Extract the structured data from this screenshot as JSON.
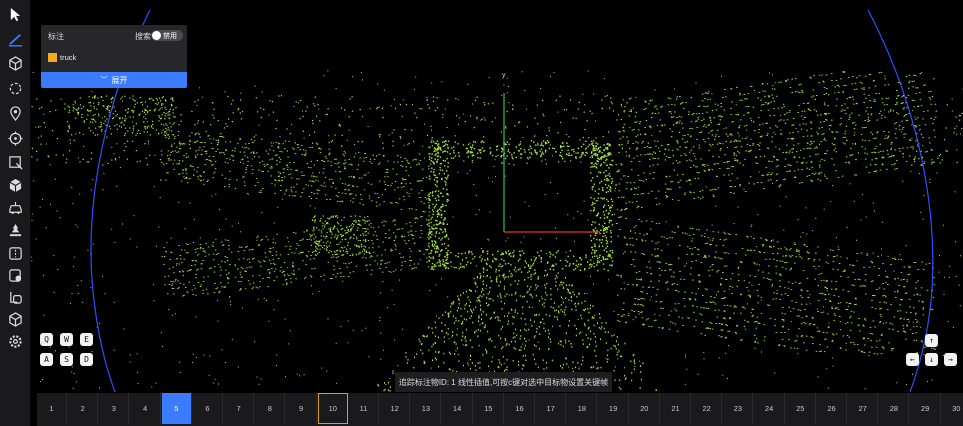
{
  "panel": {
    "title": "标注",
    "search_label": "搜索",
    "search_toggle_text": "禁用",
    "labels": [
      {
        "name": "truck",
        "color": "#f5a623"
      }
    ],
    "expand_label": "展开"
  },
  "axes": {
    "y_label": "y"
  },
  "keys": {
    "q": "Q",
    "w": "W",
    "e": "E",
    "a": "A",
    "s": "S",
    "d": "D",
    "up": "↑",
    "left": "←",
    "down": "↓",
    "right": "→"
  },
  "status_text": "追踪标注物ID: 1 线性插值,可按c键对选中目标物设置关键帧",
  "frames": {
    "items": [
      "1",
      "2",
      "3",
      "4",
      "5",
      "6",
      "7",
      "8",
      "9",
      "10",
      "11",
      "12",
      "13",
      "14",
      "15",
      "16",
      "17",
      "18",
      "19",
      "20",
      "21",
      "22",
      "23",
      "24",
      "25",
      "26",
      "27",
      "28",
      "29",
      "30"
    ],
    "current": "5",
    "marked": "10"
  },
  "colors": {
    "points": "#a8e63a",
    "accent": "#3b7cff",
    "marker": "#d9a21e",
    "ring": "#2f4fff"
  },
  "toolbar": {
    "tools": [
      "pointer-icon",
      "line-icon",
      "cube-icon",
      "polygon-icon",
      "pin-icon",
      "target-icon",
      "box-select-icon",
      "box3d-icon",
      "car-icon",
      "tree-icon",
      "frame-icon",
      "camera-icon",
      "copy-icon",
      "cube-outline-icon",
      "settings-icon"
    ]
  }
}
